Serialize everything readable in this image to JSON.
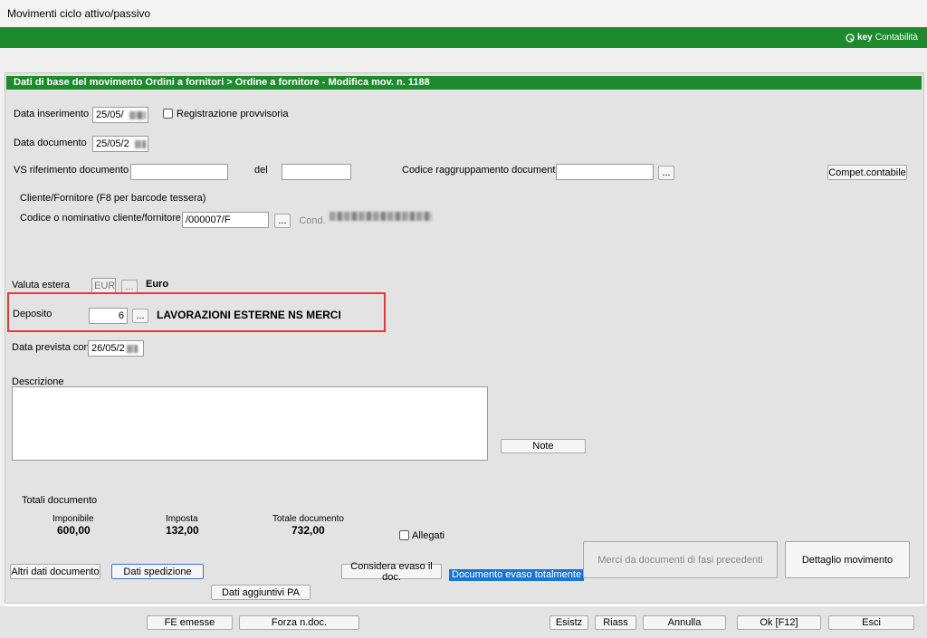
{
  "window": {
    "title": "Movimenti ciclo attivo/passivo"
  },
  "brand": {
    "key": "key",
    "name": "Contabilità"
  },
  "section": {
    "header": "Dati di base del  movimento    Ordini a fornitori > Ordine a fornitore - Modifica mov. n.  1188"
  },
  "fields": {
    "data_inserimento_label": "Data inserimento",
    "data_inserimento": "25/05/",
    "registrazione_provvisoria": "Registrazione provvisoria",
    "data_documento_label": "Data documento",
    "data_documento": "25/05/2",
    "vs_rif_label": "VS riferimento documento",
    "vs_rif_value": "",
    "del_label": "del",
    "del_value": "",
    "codice_raggr_label": "Codice raggruppamento documenti",
    "codice_raggr_value": "",
    "compet_button": "Compet.contabile",
    "cliente_fornitore_label": "Cliente/Fornitore (F8 per barcode tessera)",
    "codice_nominativo_label": "Codice o nominativo cliente/fornitore",
    "codice_nominativo_value": "/000007/F",
    "cond_button": "Cond.",
    "valuta_label": "Valuta estera",
    "valuta_value": "EUR",
    "valuta_desc": "Euro",
    "deposito_label": "Deposito",
    "deposito_value": "6",
    "deposito_desc": "LAVORAZIONI ESTERNE NS MERCI",
    "data_prevista_label": "Data prevista cons",
    "data_prevista_value": "26/05/2",
    "descrizione_label": "Descrizione",
    "descrizione_value": "",
    "note_button": "Note",
    "ellipsis": "..."
  },
  "totals": {
    "header": "Totali documento",
    "imponibile_label": "Imponibile",
    "imponibile_value": "600,00",
    "imposta_label": "Imposta",
    "imposta_value": "132,00",
    "totale_label": "Totale documento",
    "totale_value": "732,00",
    "allegati": "Allegati"
  },
  "actions": {
    "altri_dati": "Altri dati documento",
    "dati_spedizione": "Dati spedizione",
    "dati_aggiuntivi": "Dati aggiuntivi PA",
    "considera_evaso": "Considera evaso il doc.",
    "status_evaso": "Documento evaso totalmente",
    "merci_fasi": "Merci da documenti di fasi precedenti",
    "dettaglio": "Dettaglio movimento"
  },
  "bottom": {
    "fe_emesse": "FE emesse",
    "forza_ndoc": "Forza n.doc.",
    "esistz": "Esistz",
    "riass": "Riass",
    "annulla": "Annulla",
    "ok": "Ok [F12]",
    "esci": "Esci"
  }
}
